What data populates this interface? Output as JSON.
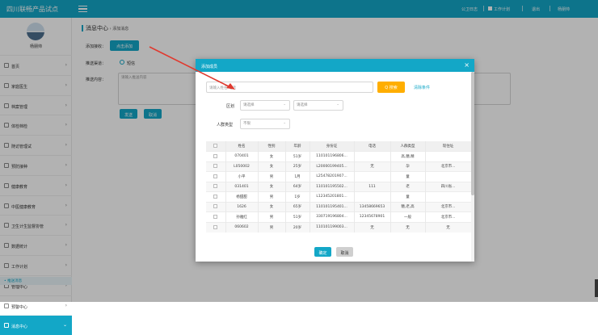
{
  "topbar": {
    "brand": "四川联畅产品试点",
    "links": [
      "公卫日志",
      "工作计划",
      "退出",
      "杨朋帅"
    ]
  },
  "user": {
    "name": "杨朋帅"
  },
  "sidebar": {
    "items": [
      {
        "label": "首页",
        "icon": "home-icon"
      },
      {
        "label": "家庭医生",
        "icon": "doctor-icon"
      },
      {
        "label": "档案管理",
        "icon": "archive-icon"
      },
      {
        "label": "体检档检",
        "icon": "exam-icon"
      },
      {
        "label": "随访管理试",
        "icon": "followup-icon"
      },
      {
        "label": "预防接种",
        "icon": "vaccine-icon"
      },
      {
        "label": "健康教育",
        "icon": "education-icon"
      },
      {
        "label": "中医健康教育",
        "icon": "tcm-icon"
      },
      {
        "label": "卫生计生监督协管",
        "icon": "supervise-icon"
      },
      {
        "label": "数据统计",
        "icon": "stats-icon"
      },
      {
        "label": "工作计划",
        "icon": "plan-icon"
      },
      {
        "label": "管理中心",
        "icon": "admin-icon"
      },
      {
        "label": "预警中心",
        "icon": "alert-icon"
      },
      {
        "label": "消息中心",
        "icon": "message-icon"
      }
    ],
    "sub_item": "• 推送消息"
  },
  "page": {
    "title": "消息中心",
    "crumb": "添加消息",
    "form": {
      "add_label": "添加接收：",
      "add_button": "点击添加",
      "method_label": "推送渠道：",
      "method_option": "短信",
      "content_label": "推送内容：",
      "content_placeholder": "请输入推送内容",
      "send_button": "发送",
      "cancel_button": "取消"
    }
  },
  "dialog": {
    "title": "添加成员",
    "search_placeholder": "请输入姓名/电话",
    "search_button": "Q 搜索",
    "clear_link": "清除条件",
    "region_label": "区划",
    "region_select1": "请选择",
    "region_select2": "请选择",
    "type_label": "人群类型",
    "type_select": "不限",
    "columns": [
      "姓名",
      "性别",
      "年龄",
      "身份证",
      "电话",
      "人群类型",
      "现住址"
    ],
    "rows": [
      [
        "070401",
        "女",
        "51岁",
        "110101196806...",
        "",
        "高,糖,精",
        ""
      ],
      [
        "L050002",
        "女",
        "25岁",
        "L20000199405...",
        "无",
        "孕",
        "北京市..."
      ],
      [
        "小平",
        "男",
        "1月",
        "L25478201907...",
        "",
        "童",
        ""
      ],
      [
        "031401",
        "女",
        "64岁",
        "110101195502...",
        "111",
        "老",
        "四川省..."
      ],
      [
        "杨甜甜",
        "男",
        "1岁",
        "L12345201801...",
        "",
        "童",
        ""
      ],
      [
        "1626",
        "女",
        "65岁",
        "110101195401...",
        "13458669653",
        "糖,老,高",
        "北京市..."
      ],
      [
        "孙雅红",
        "男",
        "51岁",
        "330719196804...",
        "12345678901",
        "一般",
        "北京市..."
      ],
      [
        "060602",
        "男",
        "20岁",
        "110101199003...",
        "无",
        "无",
        "无"
      ]
    ],
    "ok_button": "确定",
    "cancel_button": "取消"
  },
  "colors": {
    "accent": "#13a7c7",
    "search": "#ffae00",
    "arrow": "#e03a2f"
  }
}
